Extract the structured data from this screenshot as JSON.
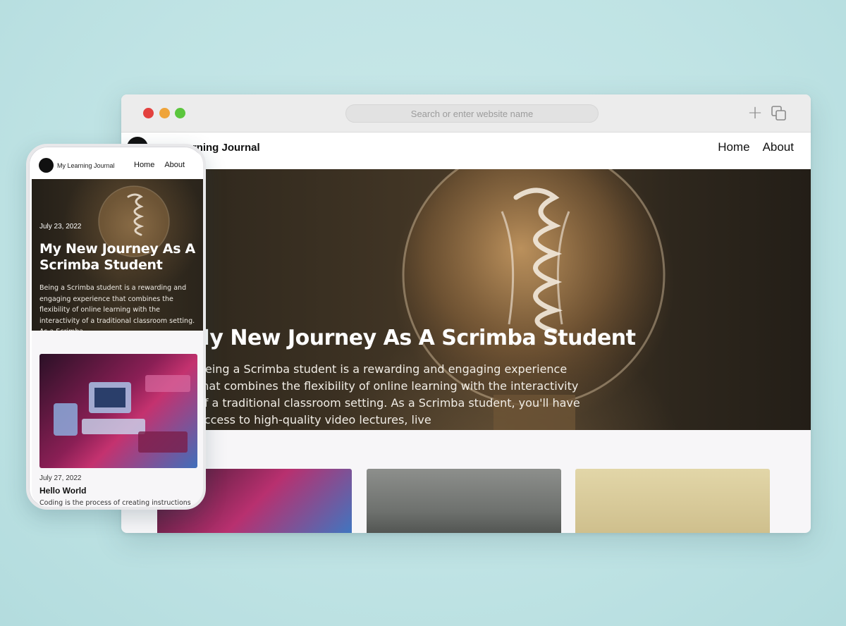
{
  "browser": {
    "url_placeholder": "Search or enter website name",
    "new_tab_icon": "plus-icon",
    "tabs_icon": "tabs-overview-icon",
    "colors": {
      "close": "#e3413e",
      "minimize": "#efa43a",
      "maximize": "#5bc63d"
    }
  },
  "desktop_site": {
    "title": "My Learning Journal",
    "nav": [
      "Home",
      "About"
    ],
    "hero": {
      "title": "My New Journey As A Scrimba Student",
      "text": "Being a Scrimba student is a rewarding and engaging experience that combines the flexibility of online learning with the interactivity of a traditional classroom setting. As a Scrimba student, you'll have access to high-quality video lectures, live"
    },
    "cards": [
      "retro-computers-image",
      "misty-lake-image",
      "retro-tv-robot-image"
    ]
  },
  "mobile_site": {
    "title": "My Learning Journal",
    "nav": [
      "Home",
      "About"
    ],
    "hero": {
      "date": "July 23, 2022",
      "title": "My New Journey As A Scrimba Student",
      "text": "Being a Scrimba student is a rewarding and engaging experience that combines the flexibility of online learning with the interactivity of a traditional classroom setting. As a Scrimba"
    },
    "post": {
      "date": "July 27, 2022",
      "title": "Hello World",
      "text": "Coding is the process of creating instructions"
    }
  }
}
